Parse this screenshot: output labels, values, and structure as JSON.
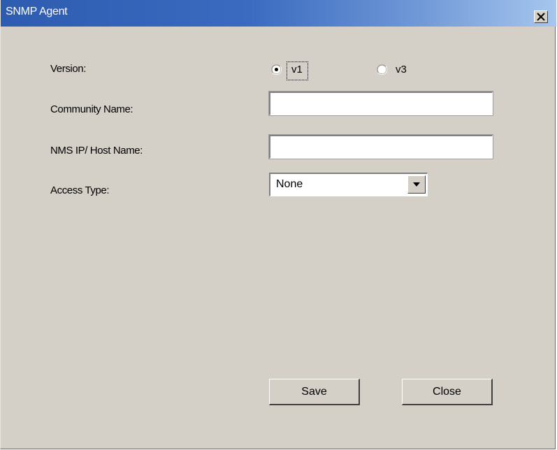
{
  "window": {
    "title": "SNMP Agent"
  },
  "form": {
    "version_label": "Version:",
    "version_options": [
      {
        "label": "v1",
        "selected": true
      },
      {
        "label": "v3",
        "selected": false
      }
    ],
    "community_label": "Community Name:",
    "community_value": "",
    "nms_label": "NMS IP/ Host Name:",
    "nms_value": "",
    "access_label": "Access Type:",
    "access_value": "None"
  },
  "buttons": {
    "save_label": "Save",
    "close_label": "Close"
  },
  "icons": {
    "close": "close-x-icon",
    "dropdown": "chevron-down-icon"
  },
  "colors": {
    "titlebar_start": "#2d5cb0",
    "titlebar_end": "#a6c6ee",
    "face": "#d4d0c8"
  }
}
